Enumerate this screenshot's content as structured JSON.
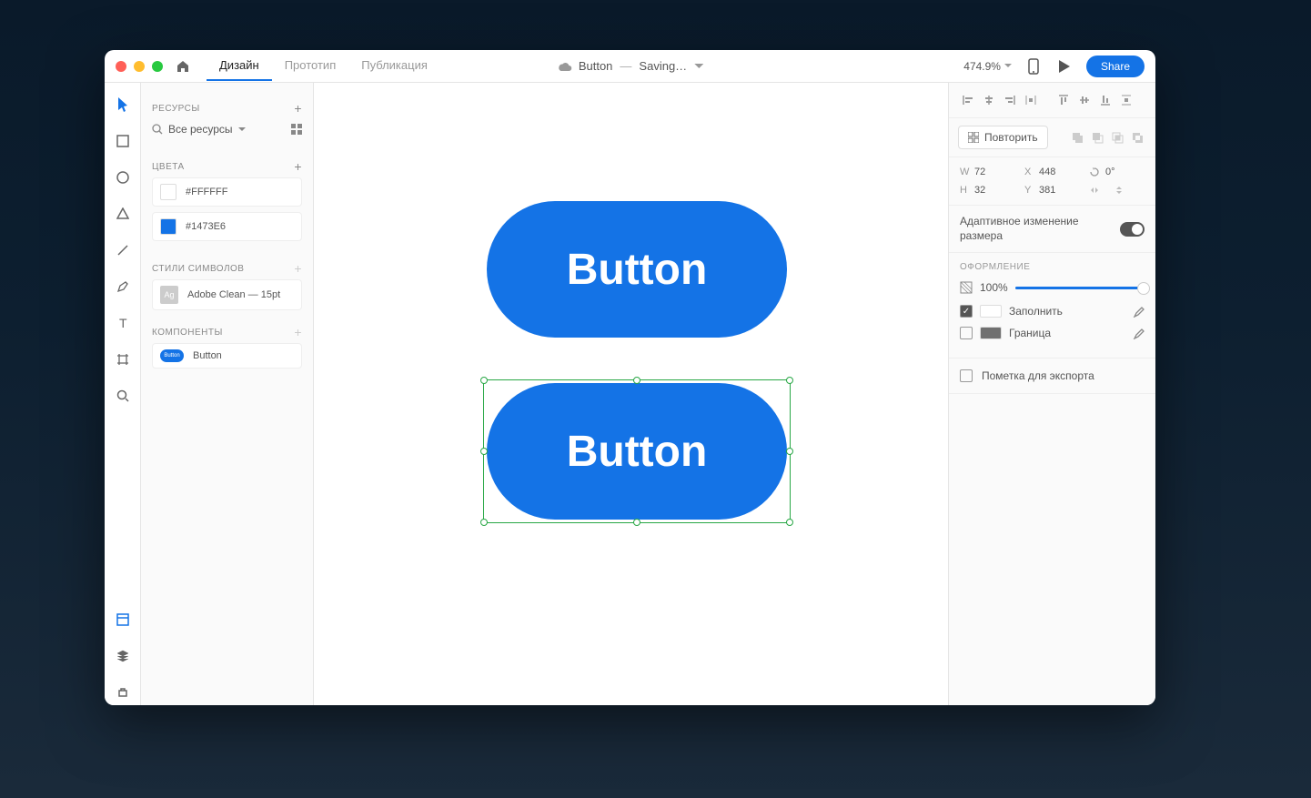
{
  "header": {
    "tabs": [
      "Дизайн",
      "Прототип",
      "Публикация"
    ],
    "active_tab": 0,
    "doc_name": "Button",
    "status": "Saving…",
    "zoom": "474.9%",
    "share_label": "Share"
  },
  "left_panel": {
    "resources_title": "РЕСУРСЫ",
    "search_dropdown": "Все ресурсы",
    "colors_title": "Цвета",
    "colors": [
      {
        "hex": "#FFFFFF",
        "label": "#FFFFFF"
      },
      {
        "hex": "#1473E6",
        "label": "#1473E6"
      }
    ],
    "char_styles_title": "Стили символов",
    "char_styles": [
      {
        "badge": "Ag",
        "label": "Adobe Clean — 15pt"
      }
    ],
    "components_title": "Компоненты",
    "components": [
      {
        "label": "Button"
      }
    ]
  },
  "canvas": {
    "button_text_1": "Button",
    "button_text_2": "Button",
    "button_color": "#1473E6"
  },
  "right_panel": {
    "repeat_label": "Повторить",
    "transform": {
      "w": "72",
      "x": "448",
      "rotation": "0°",
      "h": "32",
      "y": "381"
    },
    "responsive_label": "Адаптивное изменение размера",
    "appearance_title": "ОФОРМЛЕНИЕ",
    "opacity": "100%",
    "fill_label": "Заполнить",
    "fill_color": "#FFFFFF",
    "border_label": "Граница",
    "border_color": "#707070",
    "export_label": "Пометка для экспорта"
  }
}
